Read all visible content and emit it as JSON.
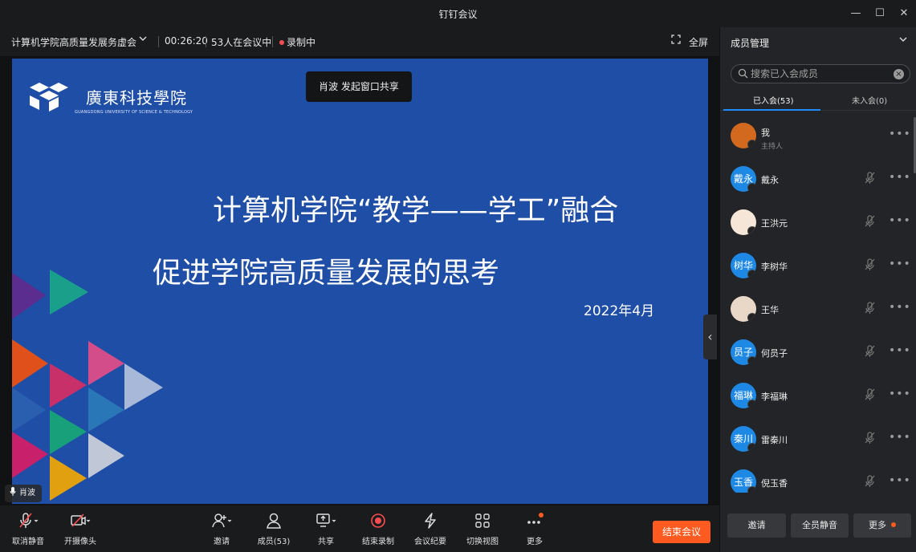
{
  "window": {
    "title": "钉钉会议",
    "minimize": "—",
    "maximize": "☐",
    "close": "✕"
  },
  "meeting": {
    "name": "计算机学院高质量发展务虚会",
    "duration": "00:26:20",
    "participants": "53人在会议中",
    "recording": "录制中",
    "fullscreen": "全屏"
  },
  "share": {
    "tip": "肖波 发起窗口共享",
    "speaker": "肖波"
  },
  "slide": {
    "logo_text": "廣東科技學院",
    "logo_sub": "GUANGDONG UNIVERSITY OF SCIENCE & TECHNOLOGY",
    "title_line1": "计算机学院“教学——学工”融合",
    "title_line2": "促进学院高质量发展的思考",
    "date": "2022年4月"
  },
  "toolbar": {
    "items": [
      {
        "label": "取消静音",
        "icon": "microphone-icon"
      },
      {
        "label": "开摄像头",
        "icon": "camera-off-icon"
      },
      {
        "label": "邀请",
        "icon": "add-user-icon"
      },
      {
        "label": "成员(53)",
        "icon": "members-icon"
      },
      {
        "label": "共享",
        "icon": "share-screen-icon"
      },
      {
        "label": "结束录制",
        "icon": "stop-record-icon"
      },
      {
        "label": "会议纪要",
        "icon": "minutes-icon"
      },
      {
        "label": "切换视图",
        "icon": "grid-view-icon"
      },
      {
        "label": "更多",
        "icon": "more-icon"
      }
    ],
    "end_meeting": "结束会议"
  },
  "panel": {
    "title": "成员管理",
    "search_placeholder": "搜索已入会成员",
    "tabs": [
      "已入会(53)",
      "未入会(0)"
    ],
    "members": [
      {
        "name": "我",
        "role": "主持人",
        "avatar_text": "",
        "avatar_color": "#d2691e"
      },
      {
        "name": "戴永",
        "role": "",
        "avatar_text": "戴永",
        "avatar_color": "#1e88e5"
      },
      {
        "name": "王洪元",
        "role": "",
        "avatar_text": "",
        "avatar_color": "#f5e6d8"
      },
      {
        "name": "李树华",
        "role": "",
        "avatar_text": "树华",
        "avatar_color": "#1e88e5"
      },
      {
        "name": "王华",
        "role": "",
        "avatar_text": "",
        "avatar_color": "#e9d8c8"
      },
      {
        "name": "何员子",
        "role": "",
        "avatar_text": "员子",
        "avatar_color": "#1e88e5"
      },
      {
        "name": "李福琳",
        "role": "",
        "avatar_text": "福琳",
        "avatar_color": "#1e88e5"
      },
      {
        "name": "雷秦川",
        "role": "",
        "avatar_text": "秦川",
        "avatar_color": "#1e88e5"
      },
      {
        "name": "倪玉香",
        "role": "",
        "avatar_text": "玉香",
        "avatar_color": "#1e88e5"
      }
    ],
    "footer": [
      "邀请",
      "全员静音",
      "更多"
    ]
  },
  "colors": {
    "accent": "#1e8bff",
    "end": "#ff5a1f",
    "slide_bg": "#1f4ea6"
  }
}
